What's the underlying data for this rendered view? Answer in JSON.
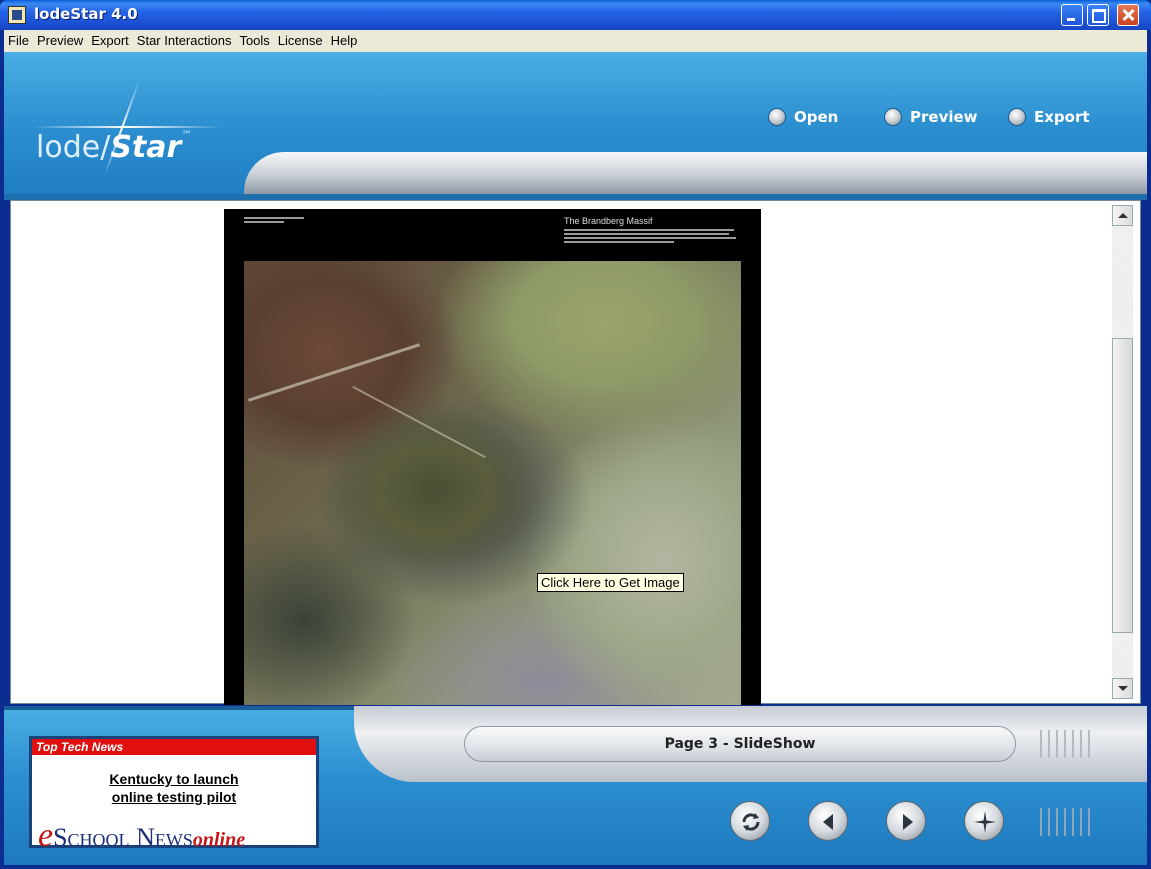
{
  "window": {
    "title": "lodeStar 4.0"
  },
  "menu": [
    "File",
    "Preview",
    "Export",
    "Star Interactions",
    "Tools",
    "License",
    "Help"
  ],
  "header": {
    "logo_text_a": "lode",
    "logo_text_b": "Star",
    "logo_tm": "™",
    "buttons": {
      "open": "Open",
      "preview": "Preview",
      "export": "Export"
    }
  },
  "content": {
    "slide_title": "The Brandberg Massif",
    "tooltip": "Click Here to Get Image"
  },
  "footer": {
    "page_label": "Page 3 - SlideShow",
    "news": {
      "header": "Top Tech News",
      "line1": "Kentucky to launch",
      "line2": "online testing pilot",
      "logo_e": "e",
      "logo_school": "School",
      "logo_news": "News",
      "logo_online": "online"
    },
    "nav_icons": [
      "refresh-icon",
      "previous-icon",
      "next-icon",
      "star-icon"
    ]
  },
  "colors": {
    "accent_blue": "#2c8fd0",
    "titlebar_blue": "#2463e6",
    "news_red": "#e01010"
  }
}
